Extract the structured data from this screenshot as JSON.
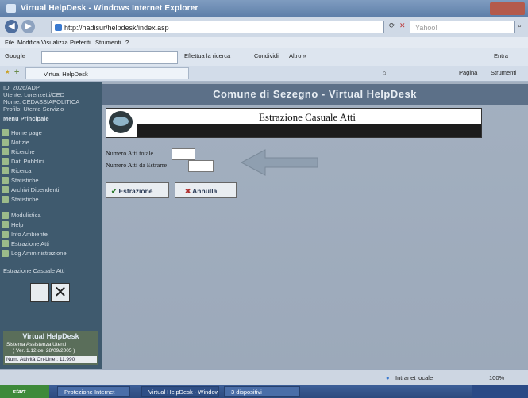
{
  "window": {
    "title": "Virtual HelpDesk - Windows Internet Explorer"
  },
  "address": {
    "url": "http://hadisur/helpdesk/index.asp",
    "search_placeholder": "Yahoo!"
  },
  "menu": {
    "items": [
      "File",
      "Modifica",
      "Visualizza",
      "Preferiti",
      "Strumenti",
      "?"
    ]
  },
  "google_toolbar": {
    "label": "Google",
    "search_button": "Effettua la ricerca",
    "share": "Condividi",
    "more": "Altro »",
    "signin": "Entra"
  },
  "favorites": {
    "tab_label": "Virtual HelpDesk",
    "pagina": "Pagina",
    "strumenti": "Strumenti"
  },
  "sidebar": {
    "user_lines": [
      "ID: 2026/ADP",
      "Utente: Lorenzetti/CED",
      "Nome: CEDASSIAPOLITICA",
      "Profilo: Utente Servizio"
    ],
    "section_title": "Menu Principale",
    "items": [
      "Home page",
      "Notizie",
      "Ricerche",
      "Dati Pubblici",
      "Ricerca",
      "Statistiche",
      "Archivi Dipendenti",
      "Statistiche",
      "Modulistica",
      "Help",
      "Info Ambiente",
      "Estrazione Atti",
      "Log Amministrazione"
    ],
    "footer_section": "Estrazione Casuale Atti",
    "brand_title": "Virtual HelpDesk",
    "brand_line1": "Sistema Assistenza Utenti",
    "brand_line2": "( Ver. 1.12 del 28/09/2005 )",
    "online_count": "Num. Attività On-Line : 11.990"
  },
  "main": {
    "banner": "Comune di Sezegno - Virtual HelpDesk",
    "page_title": "Estrazione Casuale Atti",
    "field1_label": "Numero Atti totale",
    "field2_label": "Numero Atti da Estrarre",
    "btn_extract": "Estrazione",
    "btn_cancel": "Annulla"
  },
  "statusbar": {
    "zone": "Intranet locale",
    "zoom": "100%"
  },
  "taskbar": {
    "start": "start",
    "tasks": [
      "Protezione Internet",
      "Virtual HelpDesk - Windows",
      "3 dispositivi"
    ]
  }
}
